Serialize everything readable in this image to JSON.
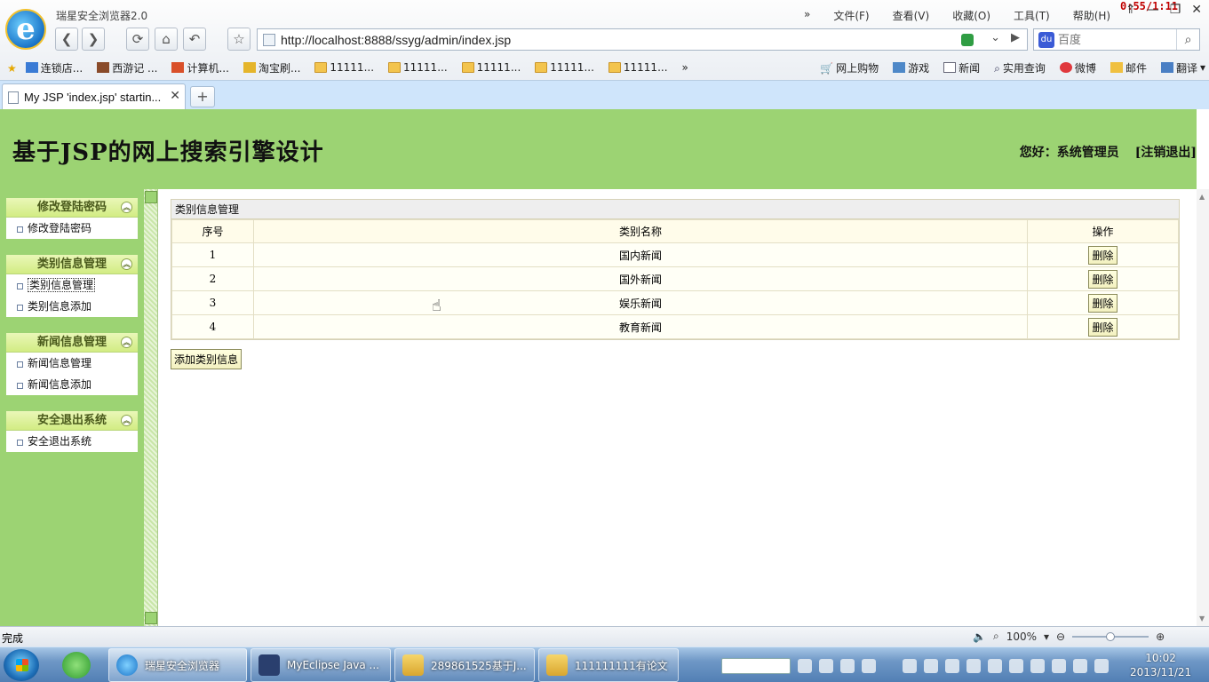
{
  "browser": {
    "app_title": "瑞星安全浏览器2.0",
    "timer": "0:55/1:11",
    "menu": [
      "文件(F)",
      "查看(V)",
      "收藏(O)",
      "工具(T)",
      "帮助(H)"
    ],
    "url": "http://localhost:8888/ssyg/admin/index.jsp",
    "search_placeholder": "百度",
    "favorites_left": [
      "连锁店...",
      "西游记 ...",
      "计算机...",
      "淘宝刷...",
      "11111...",
      "11111...",
      "11111...",
      "11111...",
      "11111..."
    ],
    "favorites_more": "»",
    "favorites_right": [
      "网上购物",
      "游戏",
      "新闻",
      "实用查询",
      "微博",
      "邮件",
      "翻译"
    ],
    "tab_title": "My JSP 'index.jsp' startin...",
    "status_text": "完成",
    "zoom_level": "100%"
  },
  "header": {
    "title": "基于JSP的网上搜索引擎设计",
    "greeting": "您好：系统管理员",
    "logout": "[注销退出]"
  },
  "sidebar": {
    "groups": [
      {
        "title": "修改登陆密码",
        "items": [
          "修改登陆密码"
        ]
      },
      {
        "title": "类别信息管理",
        "items": [
          "类别信息管理",
          "类别信息添加"
        ]
      },
      {
        "title": "新闻信息管理",
        "items": [
          "新闻信息管理",
          "新闻信息添加"
        ]
      },
      {
        "title": "安全退出系统",
        "items": [
          "安全退出系统"
        ]
      }
    ]
  },
  "main": {
    "panel_title": "类别信息管理",
    "columns": [
      "序号",
      "类别名称",
      "操作"
    ],
    "rows": [
      {
        "id": "1",
        "name": "国内新闻",
        "action": "删除"
      },
      {
        "id": "2",
        "name": "国外新闻",
        "action": "删除"
      },
      {
        "id": "3",
        "name": "娱乐新闻",
        "action": "删除"
      },
      {
        "id": "4",
        "name": "教育新闻",
        "action": "删除"
      }
    ],
    "add_button": "添加类别信息"
  },
  "taskbar": {
    "tasks": [
      "瑞星安全浏览器",
      "MyEclipse Java ...",
      "289861525基于J...",
      "111111111有论文"
    ],
    "time": "10:02",
    "date": "2013/11/21"
  }
}
